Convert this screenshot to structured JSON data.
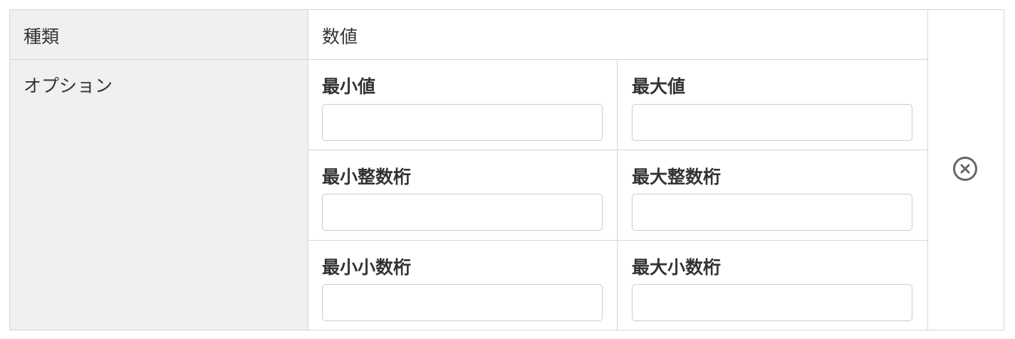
{
  "row_type": {
    "label": "種類",
    "value": "数値"
  },
  "row_options": {
    "label": "オプション",
    "fields": {
      "min_value": {
        "label": "最小値",
        "value": "",
        "placeholder": ""
      },
      "max_value": {
        "label": "最大値",
        "value": "",
        "placeholder": ""
      },
      "min_integer_digits": {
        "label": "最小整数桁",
        "value": "",
        "placeholder": ""
      },
      "max_integer_digits": {
        "label": "最大整数桁",
        "value": "",
        "placeholder": ""
      },
      "min_decimal_digits": {
        "label": "最小小数桁",
        "value": "",
        "placeholder": ""
      },
      "max_decimal_digits": {
        "label": "最大小数桁",
        "value": "",
        "placeholder": ""
      }
    }
  },
  "remove_button": {
    "icon": "circle-x-icon",
    "color": "#666666"
  }
}
